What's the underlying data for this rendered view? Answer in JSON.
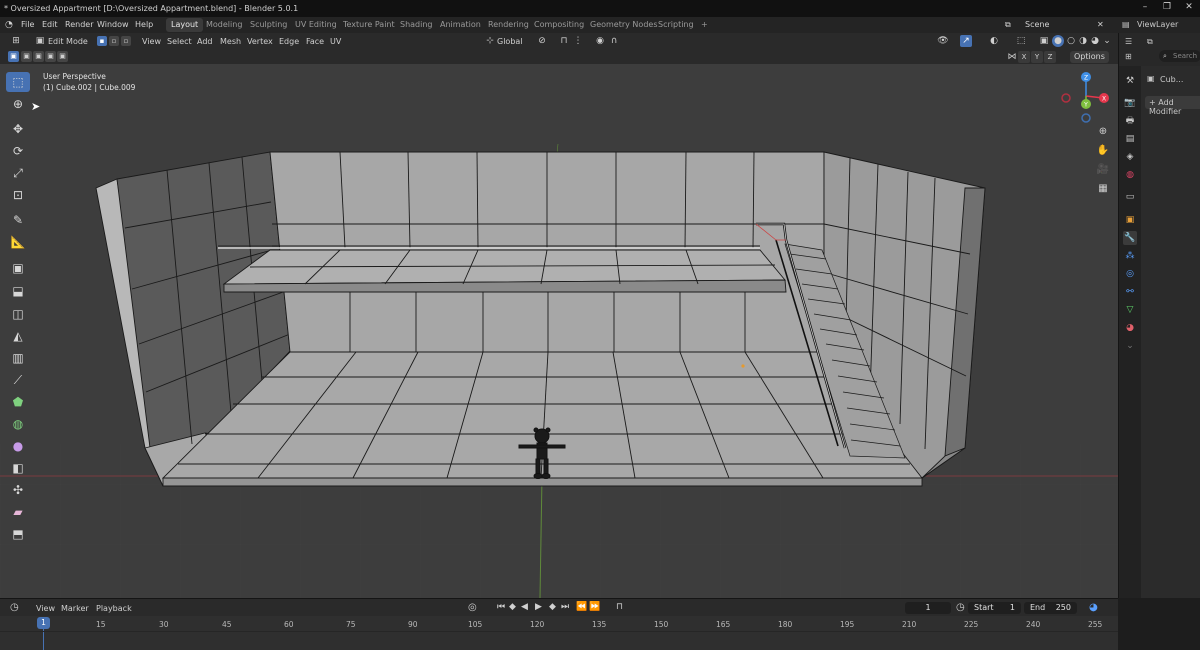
{
  "window": {
    "title": "* Oversized Appartment [D:\\Oversized Appartment.blend] - Blender 5.0.1"
  },
  "menu": {
    "items": [
      "File",
      "Edit",
      "Render",
      "Window",
      "Help"
    ]
  },
  "workspaces": {
    "tabs": [
      "Layout",
      "Modeling",
      "Sculpting",
      "UV Editing",
      "Texture Paint",
      "Shading",
      "Animation",
      "Rendering",
      "Compositing",
      "Geometry Nodes",
      "Scripting"
    ],
    "active": "Layout",
    "add": "+"
  },
  "scene": {
    "name": "Scene",
    "view_layer": "ViewLayer"
  },
  "viewport_header": {
    "mode": "Edit Mode",
    "menus": [
      "View",
      "Select",
      "Add",
      "Mesh",
      "Vertex",
      "Edge",
      "Face",
      "UV"
    ],
    "orientation": "Global",
    "options": "Options",
    "axes": [
      "X",
      "Y",
      "Z"
    ]
  },
  "viewport": {
    "perspective": "User Perspective",
    "object_info": "(1) Cube.002 | Cube.009"
  },
  "gizmo": {
    "x": "X",
    "y": "Y",
    "z": "Z"
  },
  "properties": {
    "search_placeholder": "Search",
    "object_name": "Cub...",
    "add_modifier": "Add Modifier"
  },
  "timeline": {
    "menus": [
      "View",
      "Marker",
      "Playback"
    ],
    "current_frame": "1",
    "start_label": "Start",
    "start_value": "1",
    "end_label": "End",
    "end_value": "250",
    "playhead": "1",
    "ticks": [
      "15",
      "30",
      "45",
      "60",
      "75",
      "90",
      "105",
      "120",
      "135",
      "150",
      "165",
      "180",
      "195",
      "210",
      "225",
      "240",
      "255"
    ]
  },
  "colors": {
    "accent": "#4772b3",
    "axis_x": "#e6374d",
    "axis_y": "#7fbf3f",
    "axis_z": "#3f8fe6",
    "mesh_face": "#a5a5a5",
    "mesh_edge": "#1a1a1a"
  }
}
